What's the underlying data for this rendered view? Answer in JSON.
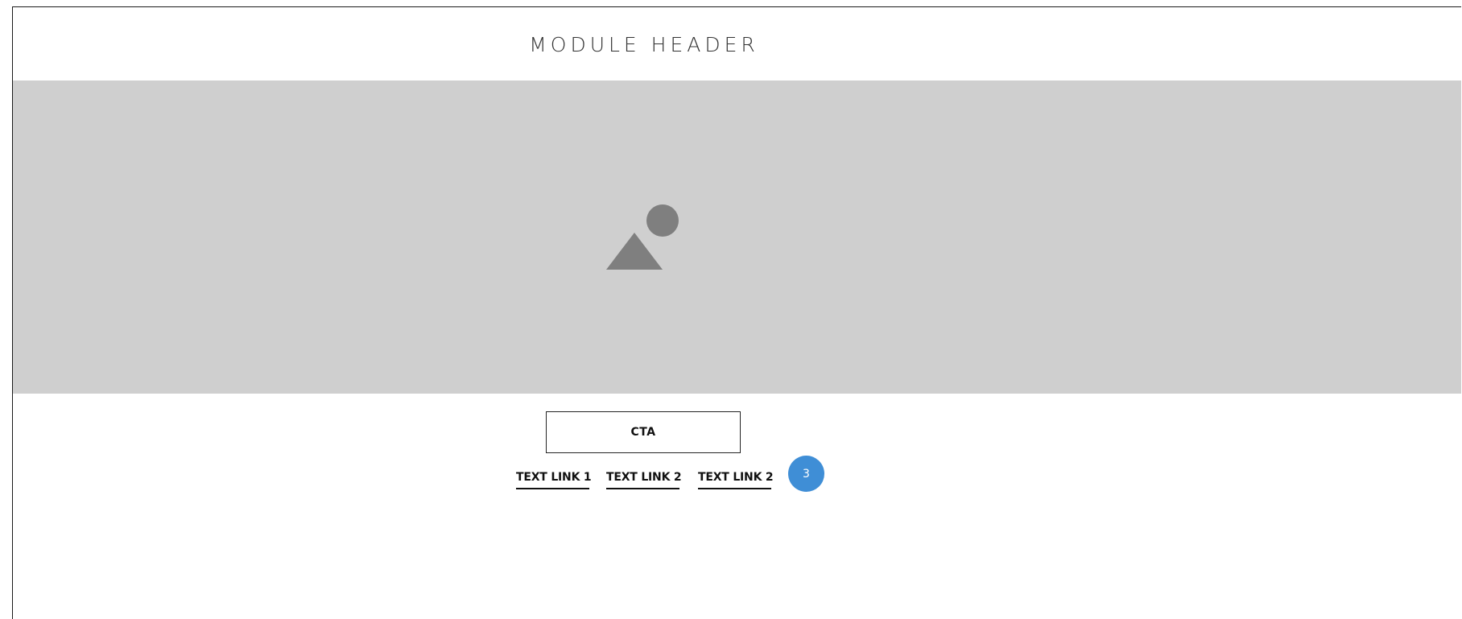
{
  "header": {
    "title": "MODULE HEADER"
  },
  "hero": {
    "image_icon": "image-placeholder-icon"
  },
  "cta": {
    "label": "CTA"
  },
  "links": [
    {
      "label": "TEXT LINK 1"
    },
    {
      "label": "TEXT LINK 2"
    },
    {
      "label": "TEXT LINK 2"
    }
  ],
  "annotation": {
    "badge": "3"
  },
  "colors": {
    "hero_background": "#cfcfcf",
    "placeholder_shape": "#7f7f7f",
    "badge": "#3f8ed6",
    "text": "#111111"
  }
}
